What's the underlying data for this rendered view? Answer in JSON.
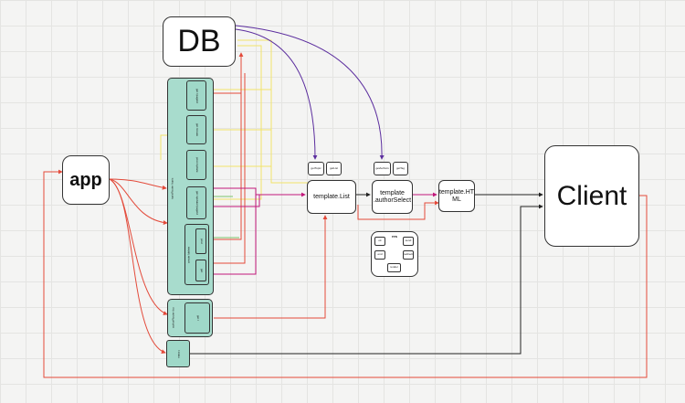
{
  "nodes": {
    "db": "DB",
    "app": "app",
    "client": "Client",
    "template_list": "template.List",
    "template_author_select": "template\n.authorSelect",
    "template_html": "template.HT\nML",
    "res": "res"
  },
  "small_labels": {
    "get_topics": "getTopic",
    "get_list": "getList",
    "get_authors": "getAuthors",
    "get_tag": "getTag"
  },
  "route_groups": {
    "topic_router": "topicRouter\n/topic",
    "author_router": "authorRouter\n/au",
    "create_label": "create\n/delete",
    "home": "/\nindex"
  },
  "routes": {
    "topic_page": "get\n/:pageId",
    "create": "get\n/create",
    "update": "post\n/update",
    "update_page": "get\n/update/:pageId",
    "post_create": "post",
    "get_delete": "get",
    "author_get": "get\n/"
  },
  "res_items": [
    "ok",
    "send",
    "end",
    "redirect",
    "render"
  ],
  "colors": {
    "red": "#e34a3a",
    "purple": "#5b2d9e",
    "yellow": "#f2e36a",
    "magenta": "#c2187b",
    "dark": "#222222",
    "teal": "#9fd8c8",
    "green": "#7cc46b"
  }
}
